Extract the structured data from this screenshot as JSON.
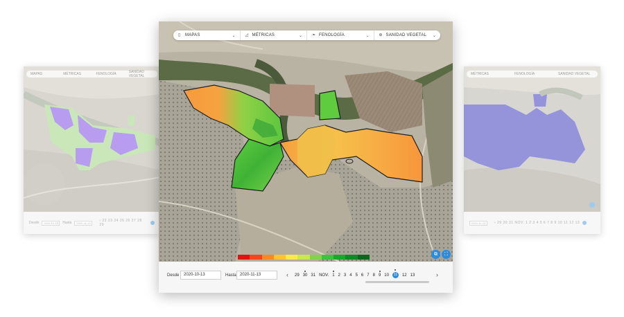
{
  "toolbar": {
    "items": [
      {
        "label": "MAPAS",
        "icon": "map-icon"
      },
      {
        "label": "MÉTRICAS",
        "icon": "chart-icon"
      },
      {
        "label": "FENOLOGÍA",
        "icon": "leaf-icon"
      },
      {
        "label": "SANIDAD VEGETAL",
        "icon": "plant-health-icon"
      }
    ],
    "chevron": "⌄"
  },
  "side_left": {
    "toolbar": [
      "MAPAS",
      "MÉTRICAS",
      "FENOLOGÍA",
      "SANIDAD VEGETAL"
    ],
    "desde_label": "Desde",
    "desde_value": "2020-10-13",
    "hasta_label": "Hasta",
    "hasta_value": "2020-11-13",
    "days": "‹  22 23 24 25 26 27 28 29"
  },
  "side_right": {
    "toolbar": [
      "MÉTRICAS",
      "FENOLOGÍA",
      "SANIDAD VEGETAL"
    ],
    "date_value": "2020-11-13",
    "days": "‹ 29 30 31 NOV. 1 2 3 4 5 6 7 8 9 10 11 12 13"
  },
  "filter": {
    "desde_label": "Desde",
    "desde_value": "2020-10-13",
    "hasta_label": "Hasta",
    "hasta_value": "2020-11-13"
  },
  "timeline": {
    "prev": "‹",
    "next": "›",
    "days": [
      {
        "label": "29",
        "dot": false,
        "selected": false
      },
      {
        "label": "30",
        "dot": true,
        "selected": false
      },
      {
        "label": "31",
        "dot": false,
        "selected": false
      },
      {
        "label": "NOV.",
        "dot": false,
        "selected": false
      },
      {
        "label": "1",
        "dot": true,
        "selected": false
      },
      {
        "label": "2",
        "dot": false,
        "selected": false
      },
      {
        "label": "3",
        "dot": false,
        "selected": false
      },
      {
        "label": "4",
        "dot": false,
        "selected": false
      },
      {
        "label": "5",
        "dot": false,
        "selected": false
      },
      {
        "label": "6",
        "dot": false,
        "selected": false
      },
      {
        "label": "7",
        "dot": false,
        "selected": false
      },
      {
        "label": "8",
        "dot": false,
        "selected": false
      },
      {
        "label": "9",
        "dot": true,
        "selected": false
      },
      {
        "label": "10",
        "dot": false,
        "selected": false
      },
      {
        "label": "11",
        "dot": true,
        "selected": true
      },
      {
        "label": "12",
        "dot": false,
        "selected": false
      },
      {
        "label": "13",
        "dot": false,
        "selected": false
      }
    ]
  },
  "map_controls": {
    "layers_icon": "layers-icon",
    "fullscreen_icon": "fullscreen-icon",
    "layers_glyph": "⧉",
    "fullscreen_glyph": "⛶"
  },
  "legend_colors": [
    "#e0140f",
    "#f5461a",
    "#f98a23",
    "#fcc431",
    "#fee84a",
    "#c8e84f",
    "#7fd44a",
    "#3cc23d",
    "#19a82e",
    "#0e8a26",
    "#08681c"
  ],
  "colors": {
    "accent": "#2d8bdc",
    "field_orange": "#f79a3e",
    "field_green": "#55c93c",
    "side_purple": "#b79cf0",
    "side_violet": "#8a87dc"
  }
}
